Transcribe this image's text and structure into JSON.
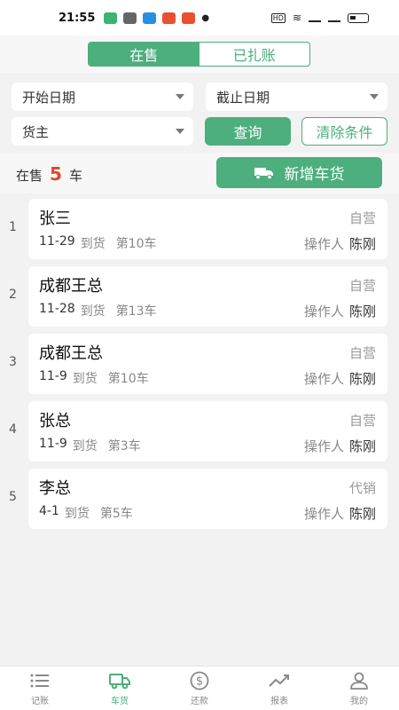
{
  "status_bar": {
    "time": "21:55"
  },
  "segments": {
    "active": "在售",
    "inactive": "已扎账"
  },
  "filters": {
    "start_date": "开始日期",
    "end_date": "截止日期",
    "owner": "货主",
    "query_label": "查询",
    "clear_label": "清除条件"
  },
  "summary": {
    "prefix": "在售",
    "count": "5",
    "unit": "车",
    "add_label": "新增车货"
  },
  "records": [
    {
      "index": "1",
      "name": "张三",
      "type": "自营",
      "date": "11-29",
      "arrive": "到货",
      "truck": "第10车",
      "operator_label": "操作人",
      "operator": "陈刚"
    },
    {
      "index": "2",
      "name": "成都王总",
      "type": "自营",
      "date": "11-28",
      "arrive": "到货",
      "truck": "第13车",
      "operator_label": "操作人",
      "operator": "陈刚"
    },
    {
      "index": "3",
      "name": "成都王总",
      "type": "自营",
      "date": "11-9",
      "arrive": "到货",
      "truck": "第10车",
      "operator_label": "操作人",
      "operator": "陈刚"
    },
    {
      "index": "4",
      "name": "张总",
      "type": "自营",
      "date": "11-9",
      "arrive": "到货",
      "truck": "第3车",
      "operator_label": "操作人",
      "operator": "陈刚"
    },
    {
      "index": "5",
      "name": "李总",
      "type": "代销",
      "date": "4-1",
      "arrive": "到货",
      "truck": "第5车",
      "operator_label": "操作人",
      "operator": "陈刚"
    }
  ],
  "tabs": [
    {
      "label": "记账",
      "icon": "list-icon"
    },
    {
      "label": "车货",
      "icon": "truck-icon"
    },
    {
      "label": "还款",
      "icon": "dollar-icon"
    },
    {
      "label": "报表",
      "icon": "trend-icon"
    },
    {
      "label": "我的",
      "icon": "user-icon"
    }
  ],
  "colors": {
    "accent": "#4caf7d",
    "count": "#e0452b"
  }
}
